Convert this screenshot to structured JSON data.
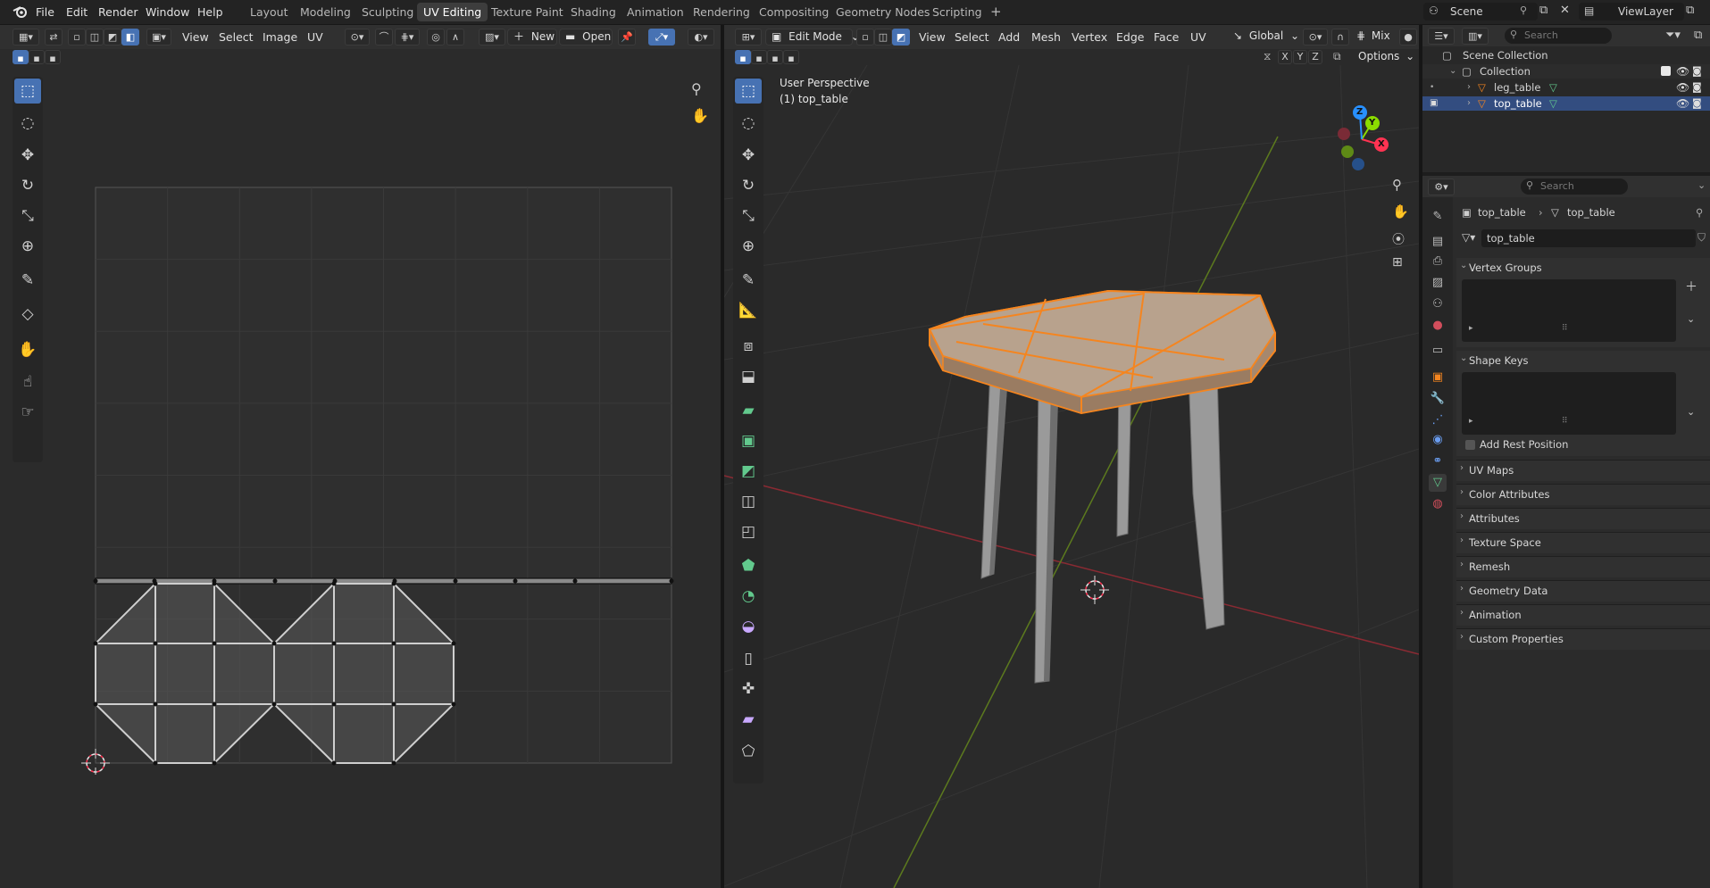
{
  "topbar": {
    "menus": [
      "File",
      "Edit",
      "Render",
      "Window",
      "Help"
    ],
    "workspaces": [
      "Layout",
      "Modeling",
      "Sculpting",
      "UV Editing",
      "Texture Paint",
      "Shading",
      "Animation",
      "Rendering",
      "Compositing",
      "Geometry Nodes",
      "Scripting"
    ],
    "active_workspace": "UV Editing",
    "add_workspace": "+",
    "scene": "Scene",
    "view_layer": "ViewLayer"
  },
  "uv_editor": {
    "menus": [
      "View",
      "Select",
      "Image",
      "UV"
    ],
    "new_label": "New",
    "open_label": "Open",
    "grid_cells": 8
  },
  "viewport": {
    "mode": "Edit Mode",
    "menus": [
      "View",
      "Select",
      "Add",
      "Mesh",
      "Vertex",
      "Edge",
      "Face",
      "UV"
    ],
    "orientation": "Global",
    "pivot": "Mix",
    "options": "Options",
    "axis_letters": [
      "X",
      "Y",
      "Z"
    ],
    "perspective_label": "User Perspective",
    "object_label": "(1) top_table",
    "gizmo": {
      "x": "X",
      "y": "Y",
      "z": "Z"
    }
  },
  "outliner": {
    "search_placeholder": "Search",
    "scene_collection": "Scene Collection",
    "collection": "Collection",
    "objects": [
      {
        "name": "leg_table",
        "selected": false
      },
      {
        "name": "top_table",
        "selected": true
      }
    ]
  },
  "properties": {
    "search_placeholder": "Search",
    "breadcrumb_object": "top_table",
    "breadcrumb_mesh": "top_table",
    "mesh_name": "top_table",
    "vertex_groups": "Vertex Groups",
    "shape_keys": "Shape Keys",
    "add_rest_position": "Add Rest Position",
    "collapsed_panels": [
      "UV Maps",
      "Color Attributes",
      "Attributes",
      "Texture Space",
      "Remesh",
      "Geometry Data",
      "Animation",
      "Custom Properties"
    ]
  },
  "colors": {
    "accent_blue": "#4772b3",
    "selection_orange": "#f5851f",
    "mesh_data_green": "#62c98d",
    "axis_red": "#ff3352",
    "axis_green": "#8bdc00",
    "axis_blue": "#2890ff"
  }
}
